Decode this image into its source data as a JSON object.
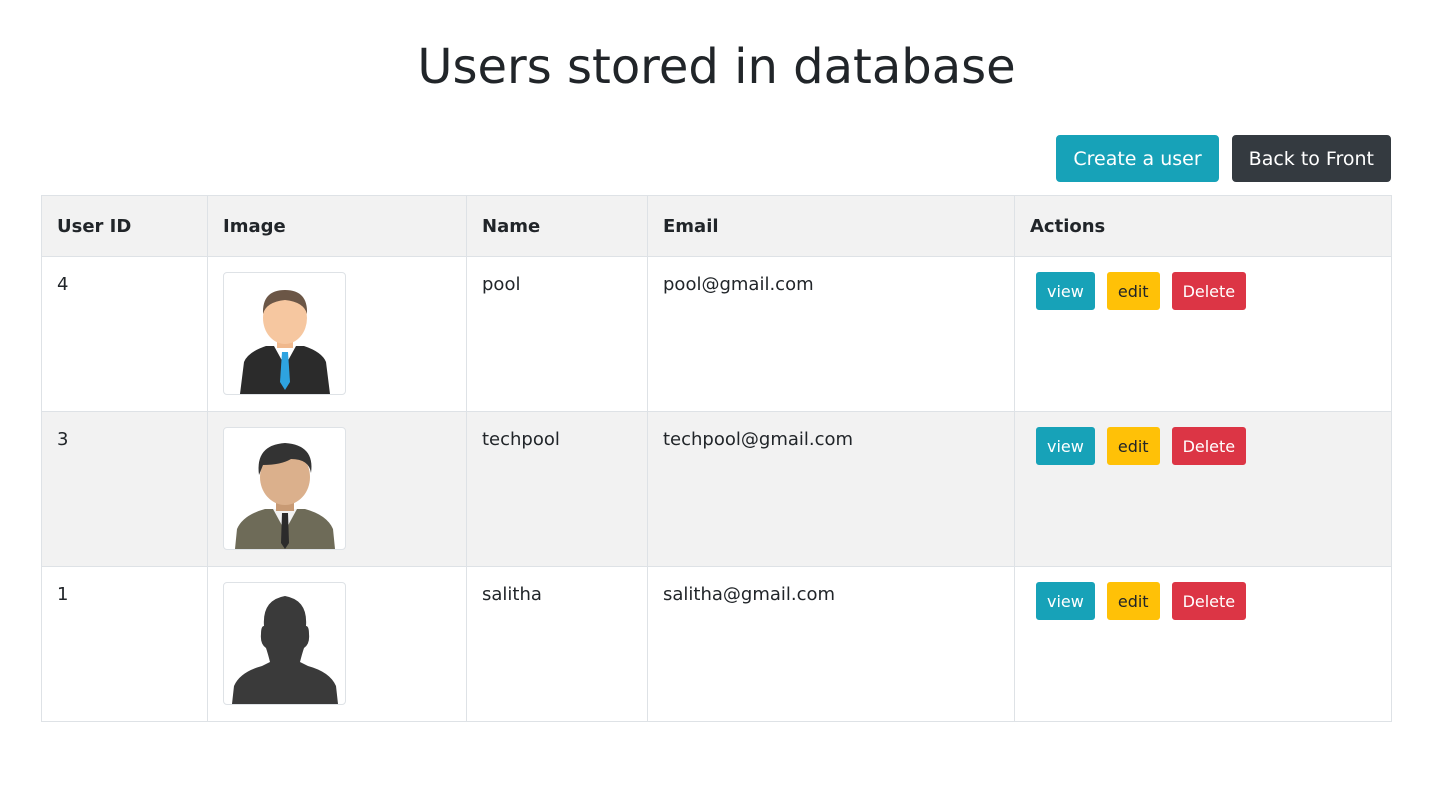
{
  "page": {
    "title": "Users stored in database"
  },
  "toolbar": {
    "create_label": "Create a user",
    "back_label": "Back to Front"
  },
  "table": {
    "headers": [
      "User ID",
      "Image",
      "Name",
      "Email",
      "Actions"
    ],
    "rows": [
      {
        "id": "4",
        "name": "pool",
        "email": "pool@gmail.com",
        "avatar": "businessman-blue-tie-avatar"
      },
      {
        "id": "3",
        "name": "techpool",
        "email": "techpool@gmail.com",
        "avatar": "businessman-grey-suit-avatar"
      },
      {
        "id": "1",
        "name": "salitha",
        "email": "salitha@gmail.com",
        "avatar": "silhouette-avatar"
      }
    ],
    "actions": {
      "view_label": "view",
      "edit_label": "edit",
      "delete_label": "Delete"
    }
  },
  "colors": {
    "info": "#17a2b8",
    "dark": "#343a40",
    "warning": "#ffc107",
    "danger": "#dc3545",
    "stripe": "#f2f2f2"
  }
}
